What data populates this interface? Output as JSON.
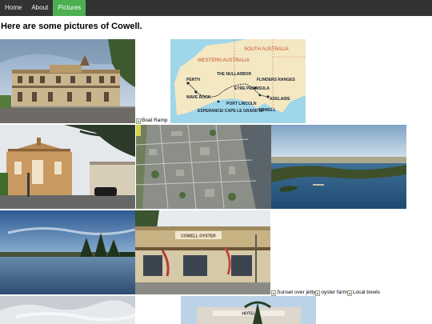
{
  "nav": {
    "items": [
      {
        "label": "Home"
      },
      {
        "label": "About"
      },
      {
        "label": "Pictures"
      }
    ],
    "active_index": 2,
    "colors": {
      "bar": "#333333",
      "active": "#4caf50",
      "text": "#f2f2f2"
    }
  },
  "heading": "Here are some pictures of Cowell.",
  "broken_images": {
    "boat_ramp": "Boat Ramp",
    "sunset_over_jetty": "Sunset over jetty",
    "oyster_farm": "oyster farm",
    "local_bowls": "Local bowls"
  },
  "map": {
    "states": [
      "WESTERN AUSTRALIA",
      "SOUTH AUSTRALIA"
    ],
    "places": [
      "PERTH",
      "WAVE ROCK",
      "THE NULLARBOR",
      "EYRE PENINSULA",
      "FLINDERS RANGES",
      "ESPERANCE/ CAPE LE GRAND NP",
      "PORT LINCOLN",
      "ADELAIDE",
      "COWELL"
    ]
  },
  "hotel_sign": "HOTEL",
  "shop_sign": "COWELL OYSTER"
}
